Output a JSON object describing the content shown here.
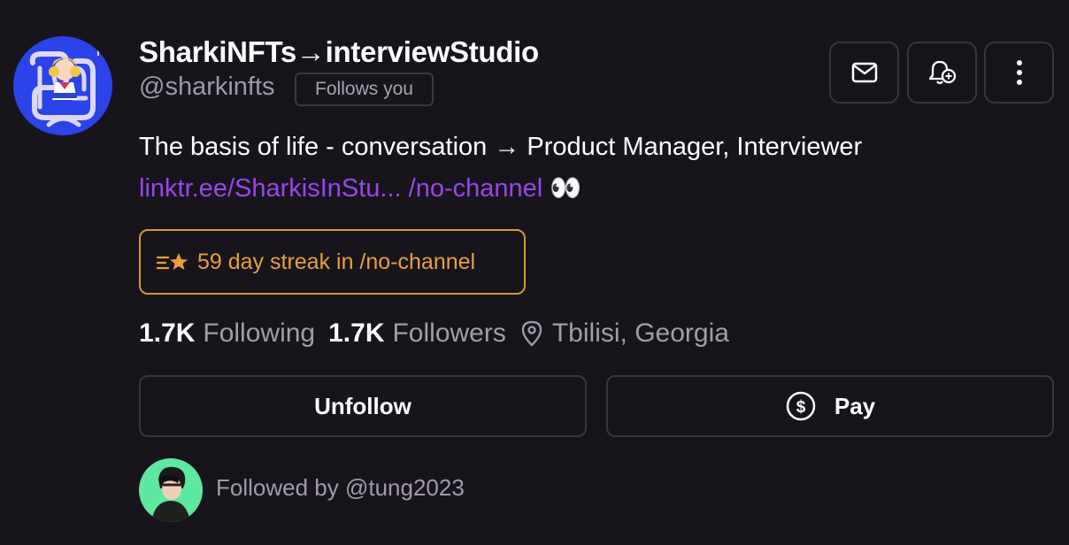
{
  "profile": {
    "display_name": "SharkiNFTs→interviewStudio",
    "handle": "@sharkinfts",
    "follows_you_badge": "Follows you",
    "bio": "The basis of life - conversation → Product Manager, Interviewer",
    "links": {
      "website": "linktr.ee/SharkisInStu...",
      "channel": "/no-channel",
      "emoji": "👀"
    },
    "streak": "59 day streak in /no-channel",
    "stats": {
      "following_count": "1.7K",
      "following_label": "Following",
      "followers_count": "1.7K",
      "followers_label": "Followers",
      "location": "Tbilisi, Georgia"
    }
  },
  "actions": {
    "unfollow_label": "Unfollow",
    "pay_label": "Pay"
  },
  "followed_by": {
    "text": "Followed by @tung2023"
  },
  "icons": {
    "message": "mail-icon",
    "notify": "bell-plus-icon",
    "more": "more-vertical-icon",
    "streak": "streak-star-icon",
    "location": "map-pin-icon",
    "pay": "dollar-circle-icon"
  },
  "colors": {
    "background": "#17141c",
    "link": "#9b45ea",
    "streak": "#e6a03a",
    "avatar_bg": "#2b43e8",
    "followed_avatar_bg": "#5ee8a0"
  }
}
